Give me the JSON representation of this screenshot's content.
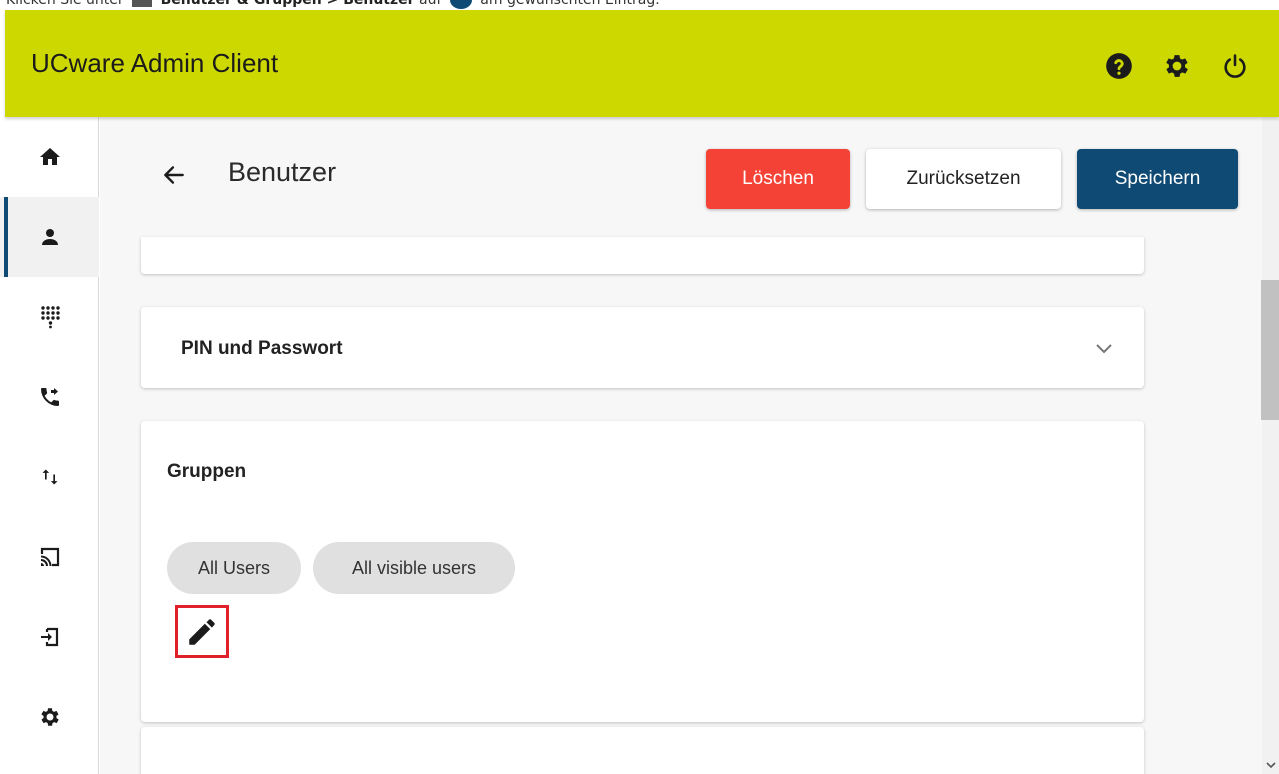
{
  "doc_strip": {
    "prefix": "Klicken Sie unter",
    "path_bold": "Benutzer & Gruppen > Benutzer",
    "middle": "auf",
    "suffix": "am gewünschten Eintrag."
  },
  "header": {
    "app_title": "UCware Admin Client",
    "icons": [
      "help-icon",
      "settings-icon",
      "power-icon"
    ],
    "background_color": "#cdd800"
  },
  "sidebar": {
    "items": [
      {
        "icon": "home-icon",
        "active": false
      },
      {
        "icon": "user-icon",
        "active": true
      },
      {
        "icon": "dialpad-icon",
        "active": false
      },
      {
        "icon": "call-forward-icon",
        "active": false
      },
      {
        "icon": "swap-vert-icon",
        "active": false
      },
      {
        "icon": "cast-icon",
        "active": false
      },
      {
        "icon": "login-icon",
        "active": false
      },
      {
        "icon": "settings-icon",
        "active": false
      }
    ],
    "active_color": "#0e4a74"
  },
  "page": {
    "title": "Benutzer",
    "buttons": {
      "delete": "Löschen",
      "reset": "Zurücksetzen",
      "save": "Speichern"
    },
    "colors": {
      "delete": "#f44336",
      "save": "#0e4a74"
    }
  },
  "sections": {
    "pin": {
      "label": "PIN und Passwort",
      "expand_icon": "chevron-down-icon"
    },
    "groups": {
      "label": "Gruppen",
      "chips": [
        "All Users",
        "All visible users"
      ],
      "edit_icon": "pencil-icon",
      "highlight_color": "#e0202b"
    }
  }
}
